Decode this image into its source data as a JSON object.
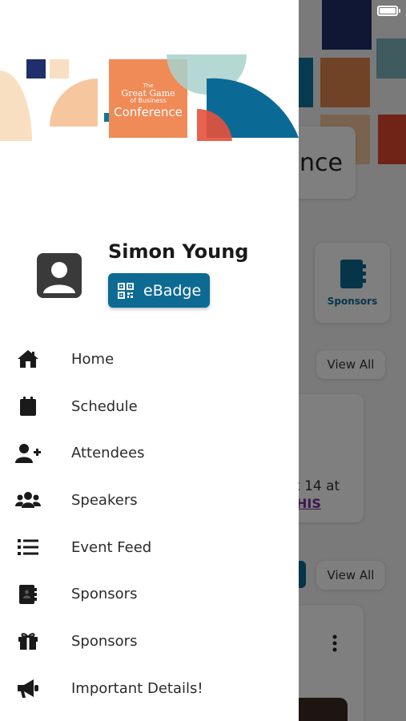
{
  "colors": {
    "brand": "#0d6a93",
    "scrim": "rgba(0,0,0,0.5)"
  },
  "banner": {
    "logo_line1": "The",
    "logo_line2": "Great Game",
    "logo_line3": "of Business",
    "logo_line4": "Conference"
  },
  "background": {
    "title_fragment": "nce",
    "sponsors_tile": "Sponsors",
    "view_all_1": "View All",
    "view_all_2": "View All",
    "card_text": "t 14 at",
    "card_link": "HIS"
  },
  "profile": {
    "name": "Simon Young",
    "ebadge_label": "eBadge",
    "avatar_icon": "user-icon",
    "ebadge_icon": "qr-code-icon"
  },
  "menu": [
    {
      "label": "Home",
      "icon": "home-icon"
    },
    {
      "label": "Schedule",
      "icon": "calendar-icon"
    },
    {
      "label": "Attendees",
      "icon": "user-plus-icon"
    },
    {
      "label": "Speakers",
      "icon": "users-icon"
    },
    {
      "label": "Event Feed",
      "icon": "list-icon"
    },
    {
      "label": "Sponsors",
      "icon": "address-book-icon"
    },
    {
      "label": "Sponsors",
      "icon": "gift-icon"
    },
    {
      "label": "Important Details!",
      "icon": "megaphone-icon"
    }
  ]
}
